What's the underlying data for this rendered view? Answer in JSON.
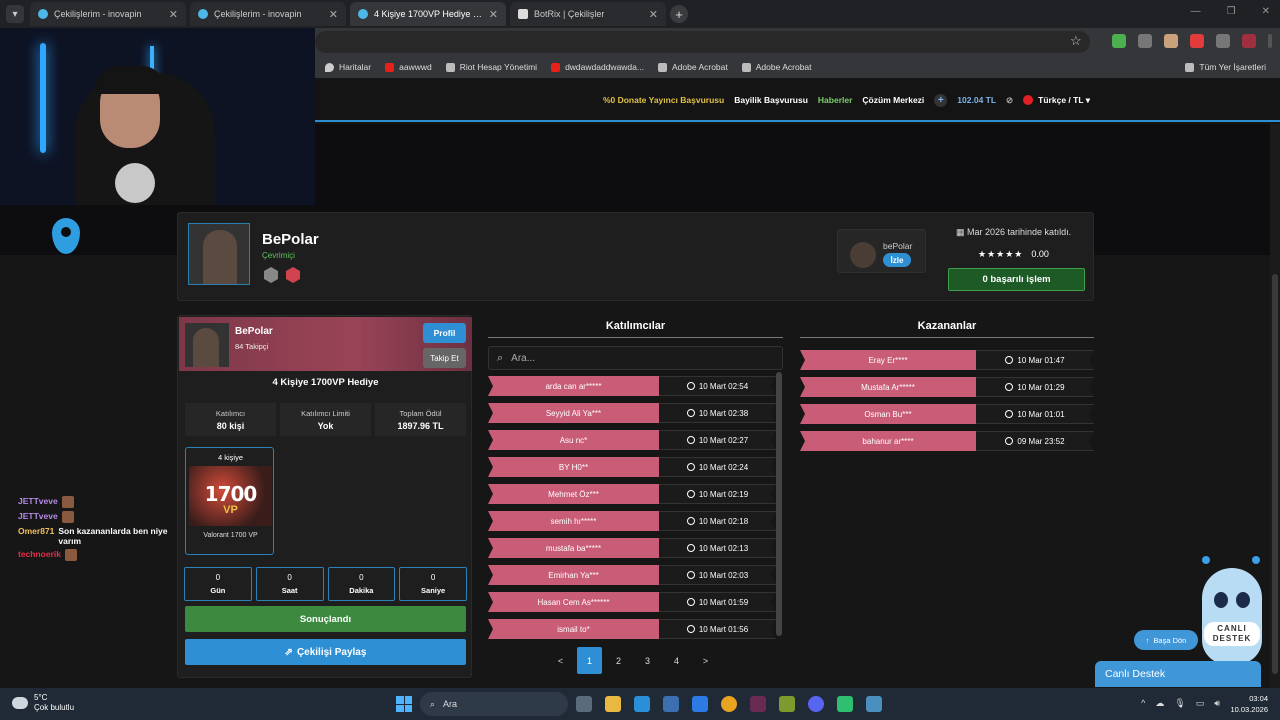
{
  "browser": {
    "tabs": [
      {
        "title": "Çekilişlerim - inovapin",
        "active": false
      },
      {
        "title": "Çekilişlerim - inovapin",
        "active": false
      },
      {
        "title": "4 Kişiye 1700VP Hediye - inova",
        "active": true
      },
      {
        "title": "BotRix | Çekilişler",
        "active": false
      }
    ],
    "bookmarks": [
      "Haritalar",
      "aawwwd",
      "Riot Hesap Yönetimi",
      "dwdawdaddwawda...",
      "Adobe Acrobat",
      "Adobe Acrobat"
    ],
    "bookmarks_all": "Tüm Yer İşaretleri"
  },
  "site_nav": {
    "donate": "%0 Donate Yayıncı Başvurusu",
    "dealer": "Bayilik Başvurusu",
    "news": "Haberler",
    "support_center": "Çözüm Merkezi",
    "plus": "+",
    "balance": "102.04 TL",
    "language": "Türkçe / TL ▾"
  },
  "profile": {
    "name": "BePolar",
    "status": "Çevrimiçi",
    "streamer_name": "bePolar",
    "watch_label": "İzle",
    "joined": "Mar 2026 tarihinde katıldı.",
    "stars": "★★★★★",
    "rating": "0.00",
    "success": "0 başarılı işlem"
  },
  "giveaway": {
    "host": "BePolar",
    "followers": "84 Takipçi",
    "profile_btn": "Profil",
    "follow_btn": "Takip Et",
    "title": "4 Kişiye 1700VP Hediye",
    "stats": [
      {
        "label": "Katılımcı",
        "value": "80 kişi"
      },
      {
        "label": "Katılımcı Limiti",
        "value": "Yok"
      },
      {
        "label": "Toplam Ödül",
        "value": "1897.96 TL"
      }
    ],
    "prize": {
      "count": "4 kişiye",
      "num": "1700",
      "unit": "VP",
      "name": "Valorant 1700 VP"
    },
    "countdown": [
      {
        "value": "0",
        "label": "Gün"
      },
      {
        "value": "0",
        "label": "Saat"
      },
      {
        "value": "0",
        "label": "Dakika"
      },
      {
        "value": "0",
        "label": "Saniye"
      }
    ],
    "result_btn": "Sonuçlandı",
    "share_btn": "Çekilişi Paylaş"
  },
  "participants": {
    "title": "Katılımcılar",
    "search_placeholder": "Ara...",
    "rows": [
      {
        "name": "arda can ar*****",
        "time": "10 Mart 02:54"
      },
      {
        "name": "Seyyid Ali Ya***",
        "time": "10 Mart 02:38"
      },
      {
        "name": "Asu nc*",
        "time": "10 Mart 02:27"
      },
      {
        "name": "BY H0**",
        "time": "10 Mart 02:24"
      },
      {
        "name": "Mehmet Öz***",
        "time": "10 Mart 02:19"
      },
      {
        "name": "semih hı*****",
        "time": "10 Mart 02:18"
      },
      {
        "name": "mustafa ba*****",
        "time": "10 Mart 02:13"
      },
      {
        "name": "Emirhan Ya***",
        "time": "10 Mart 02:03"
      },
      {
        "name": "Hasan Cem As******",
        "time": "10 Mart 01:59"
      },
      {
        "name": "ismail to*",
        "time": "10 Mart 01:56"
      }
    ],
    "pages": [
      "<",
      "1",
      "2",
      "3",
      "4",
      ">"
    ]
  },
  "winners": {
    "title": "Kazananlar",
    "rows": [
      {
        "name": "Eray Er****",
        "time": "10 Mar 01:47"
      },
      {
        "name": "Mustafa Ar*****",
        "time": "10 Mar 01:29"
      },
      {
        "name": "Osman Bu***",
        "time": "10 Mar 01:01"
      },
      {
        "name": "bahanur ar****",
        "time": "09 Mar 23:52"
      }
    ]
  },
  "chat": [
    {
      "user": "JETTveve",
      "color": "#b58ae8",
      "msg": ""
    },
    {
      "user": "JETTveve",
      "color": "#b58ae8",
      "msg": ""
    },
    {
      "user": "Omer871",
      "color": "#f0c060",
      "msg": "Son kazananlarda ben niye varım"
    },
    {
      "user": "technoerik",
      "color": "#e0304a",
      "msg": ""
    }
  ],
  "widgets": {
    "mascot_label": "CANLI DESTEK",
    "back_to_top": "Başa Dön",
    "live_support": "Canlı Destek"
  },
  "taskbar": {
    "temp": "5°C",
    "weather": "Çok bulutlu",
    "search": "Ara",
    "time": "03:04",
    "date": "10.03.2026"
  },
  "colors": {
    "accent": "#2f8fd4",
    "row_pink": "#c95d78",
    "success_green": "#3b8a3f"
  }
}
